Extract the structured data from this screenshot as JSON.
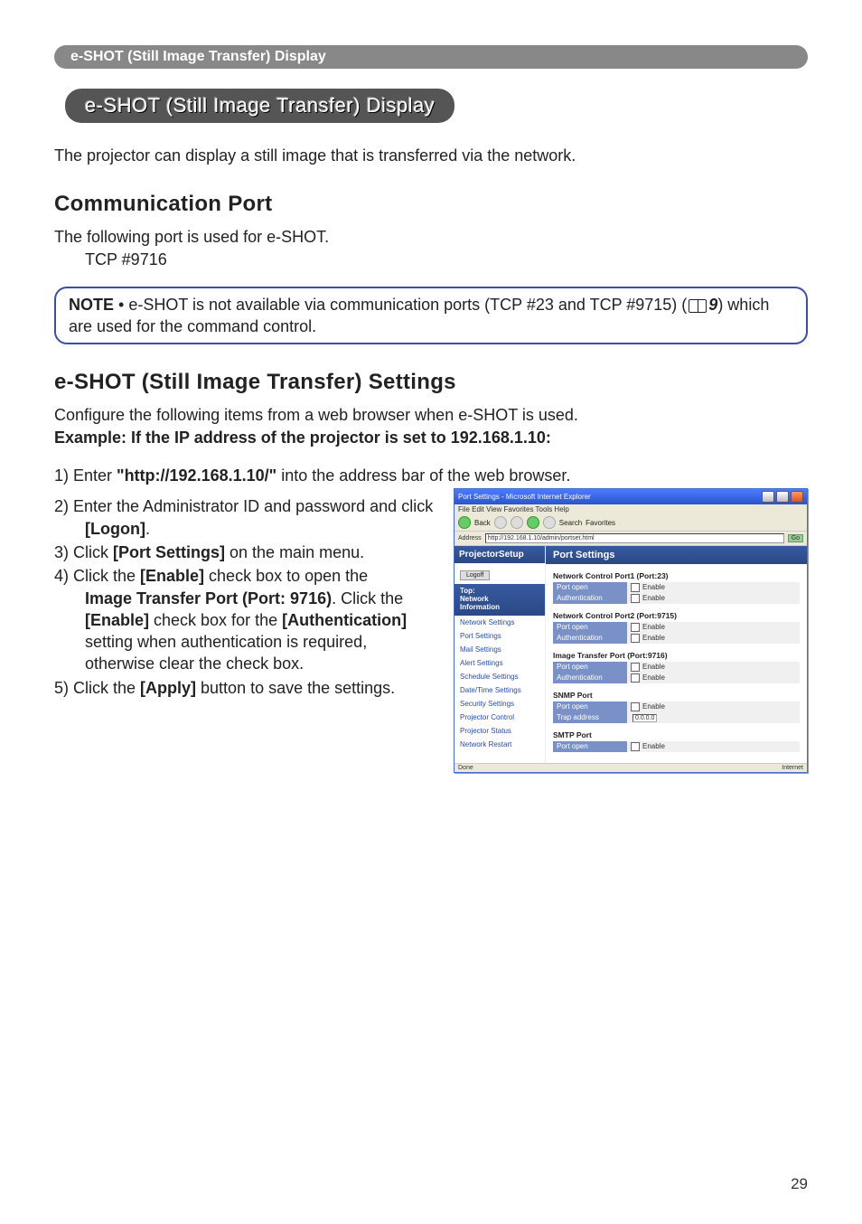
{
  "header_tab": "e-SHOT (Still Image Transfer) Display",
  "pill_title": "e-SHOT (Still Image Transfer) Display",
  "intro_text": "The projector can display a still image that is transferred via the network.",
  "comm_port": {
    "heading": "Communication Port",
    "line1": "The following port is used for e-SHOT.",
    "line2": "TCP #9716"
  },
  "note": {
    "label": "NOTE",
    "text1": " • e-SHOT is not available via communication ports (TCP #23 and TCP #9715) (",
    "ref": "9",
    "text2": ") which are used for the command control."
  },
  "settings": {
    "heading": "e-SHOT (Still Image Transfer) Settings",
    "intro1": "Configure the following items from a web browser when e-SHOT is used.",
    "intro2": "Example: If the IP address of the projector is set to 192.168.1.10:"
  },
  "steps": {
    "s1a": "1) Enter ",
    "s1b": "\"http://192.168.1.10/\"",
    "s1c": " into the address bar of the web browser.",
    "s2a": "2) Enter the Administrator ID and password and click ",
    "s2b": "[Logon]",
    "s2c": ".",
    "s3a": "3) Click ",
    "s3b": "[Port Settings]",
    "s3c": " on the main menu.",
    "s4a": "4) Click the ",
    "s4b": "[Enable]",
    "s4c": " check box to open the ",
    "s4d": "Image Transfer Port (Port: 9716)",
    "s4e": ". Click the ",
    "s4f": "[Enable]",
    "s4g": " check box for the ",
    "s4h": "[Authentication]",
    "s4i": " setting when authentication is required, otherwise clear the check box.",
    "s5a": "5) Click the ",
    "s5b": "[Apply]",
    "s5c": " button to save the settings."
  },
  "ss": {
    "wintitle": "Port Settings - Microsoft Internet Explorer",
    "menubar": "File   Edit   View   Favorites   Tools   Help",
    "back": "Back",
    "search": "Search",
    "fav": "Favorites",
    "addr_label": "Address",
    "addr_value": "http://192.168.1.10/admin/portset.html",
    "go": "Go",
    "brand": "ProjectorSetup",
    "logoff": "Logoff",
    "topgroup1": "Top:",
    "topgroup2": "Network",
    "topgroup3": "Information",
    "menu": [
      "Network Settings",
      "Port Settings",
      "Mail Settings",
      "Alert Settings",
      "Schedule Settings",
      "Date/Time Settings",
      "Security Settings",
      "Projector Control",
      "Projector Status",
      "Network Restart"
    ],
    "page_title": "Port Settings",
    "sec1": "Network Control Port1 (Port:23)",
    "sec2": "Network Control Port2 (Port:9715)",
    "sec3": "Image Transfer Port (Port:9716)",
    "sec4": "SNMP Port",
    "sec5": "SMTP Port",
    "row_portopen": "Port open",
    "row_auth": "Authentication",
    "row_trap": "Trap address",
    "enable": "Enable",
    "ip": "0.0.0.0",
    "status_done": "Done",
    "status_net": "Internet"
  },
  "page_number": "29"
}
